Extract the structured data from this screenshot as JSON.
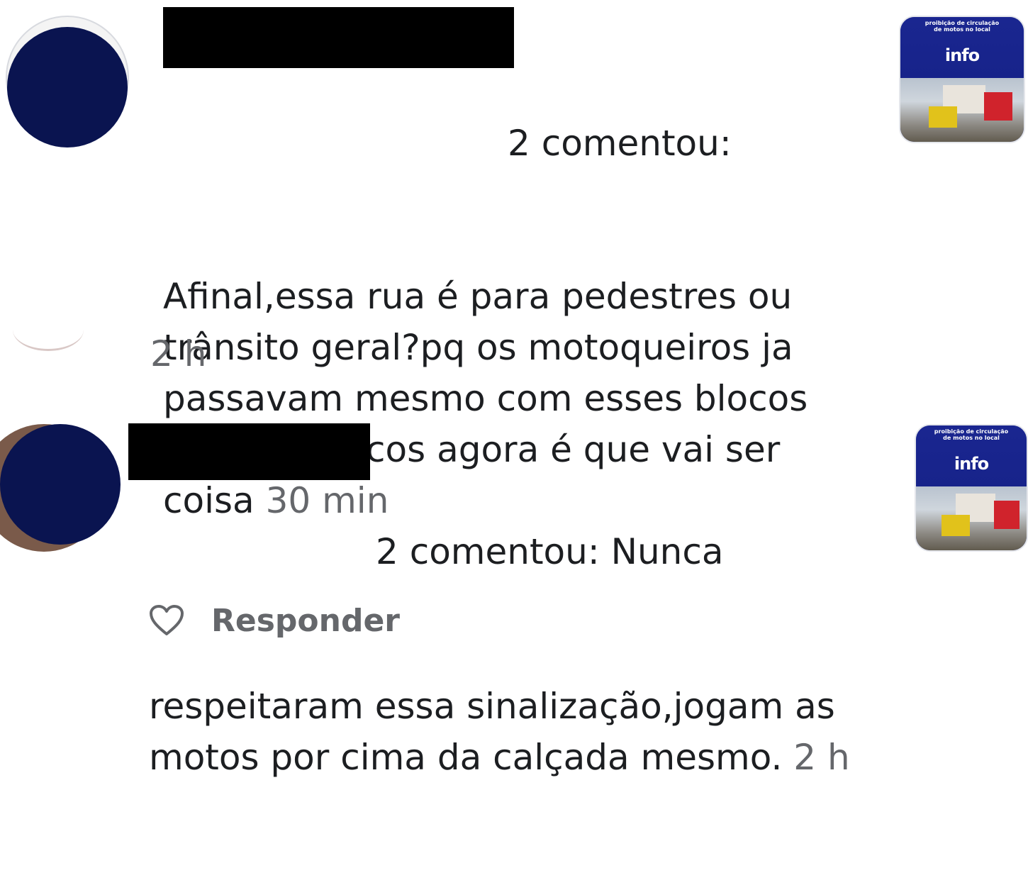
{
  "notifications": [
    {
      "author_suffix": "2 comentou:",
      "body": "Afinal,essa rua é para pedestres ou trânsito geral?pq os motoqueiros ja passavam mesmo com esses blocos ,sem os blocos agora é que vai ser coisa",
      "time": "30 min",
      "thumbnail": {
        "caption": "proibição de circulação\nde motos no local",
        "logo": "info"
      }
    },
    {
      "author_suffix": "2 comentou: Nunca",
      "body": "respeitaram essa sinalização,jogam as motos por cima da calçada mesmo.",
      "time": "2 h",
      "thumbnail": {
        "caption": "proibição de circulação\nde motos no local",
        "logo": "info"
      }
    }
  ],
  "between_time": "2 h",
  "actions": {
    "reply_label": "Responder",
    "like_icon": "heart-icon"
  },
  "colors": {
    "avatar_redaction": "#0a1450",
    "secondary_text": "#65676b",
    "primary_text": "#1c1e21"
  }
}
